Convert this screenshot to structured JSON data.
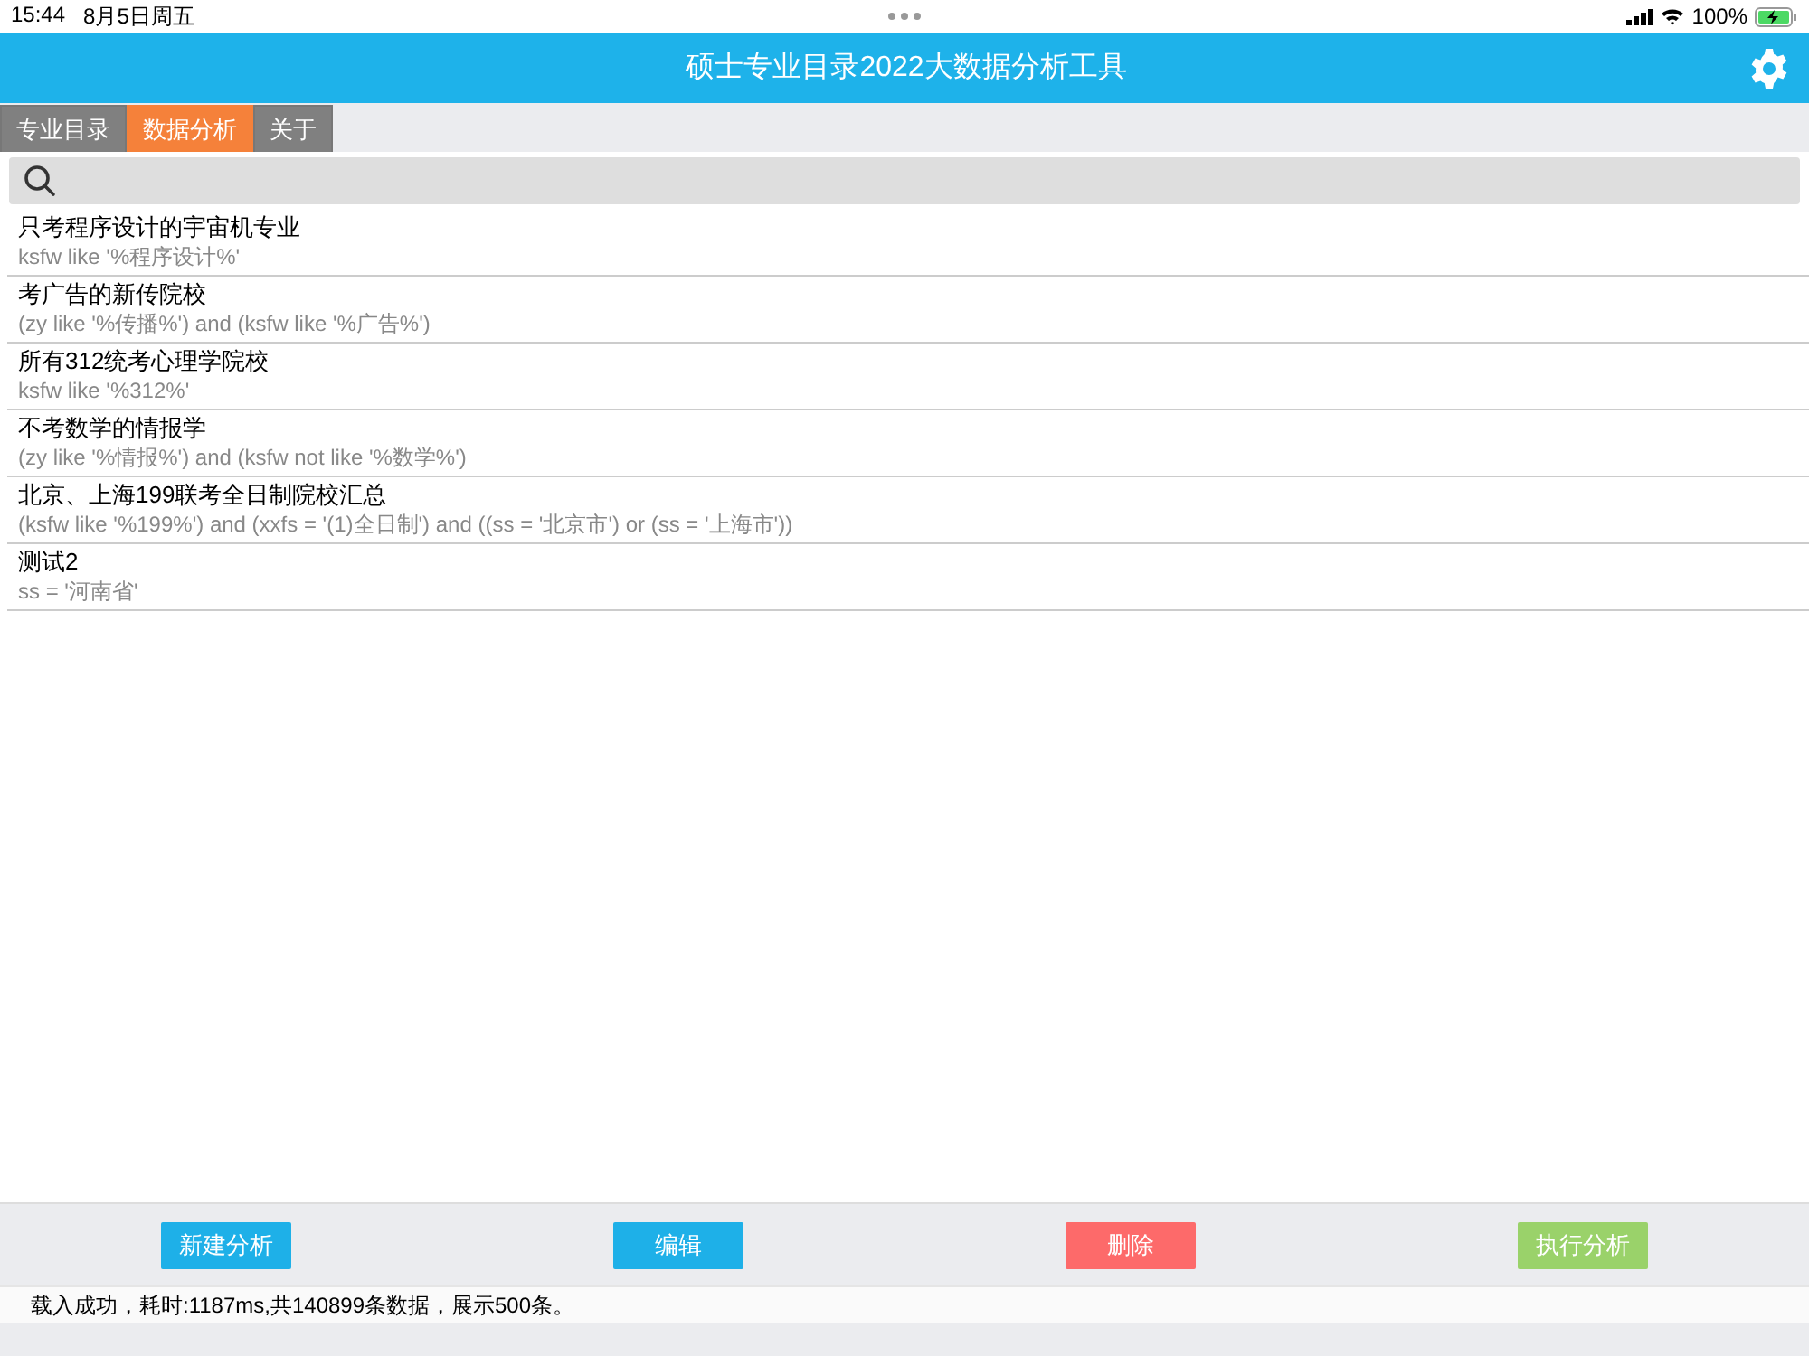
{
  "status_bar": {
    "time": "15:44",
    "date": "8月5日周五",
    "battery": "100%"
  },
  "header": {
    "title": "硕士专业目录2022大数据分析工具"
  },
  "tabs": [
    {
      "label": "专业目录",
      "selected": false
    },
    {
      "label": "数据分析",
      "selected": true
    },
    {
      "label": "关于",
      "selected": false
    }
  ],
  "analyses": [
    {
      "title": "只考程序设计的宇宙机专业",
      "query": "ksfw like '%程序设计%'"
    },
    {
      "title": "考广告的新传院校",
      "query": "(zy like '%传播%') and (ksfw like '%广告%')"
    },
    {
      "title": "所有312统考心理学院校",
      "query": "ksfw like '%312%'"
    },
    {
      "title": "不考数学的情报学",
      "query": "(zy like '%情报%') and (ksfw not like '%数学%')"
    },
    {
      "title": "北京、上海199联考全日制院校汇总",
      "query": "(ksfw like '%199%') and (xxfs = '(1)全日制') and ((ss = '北京市') or (ss = '上海市'))"
    },
    {
      "title": "测试2",
      "query": "ss = '河南省'"
    }
  ],
  "buttons": [
    {
      "label": "新建分析",
      "color": "#1eb0e8"
    },
    {
      "label": "编辑",
      "color": "#1eb0e8"
    },
    {
      "label": "删除",
      "color": "#fd6a6a"
    },
    {
      "label": "执行分析",
      "color": "#9ad26a"
    }
  ],
  "message": "载入成功，耗时:1187ms,共140899条数据，展示500条。"
}
